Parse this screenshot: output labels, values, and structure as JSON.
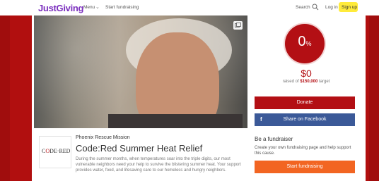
{
  "nav": {
    "logo": "JustGiving",
    "menu": "Menu",
    "start": "Start fundraising",
    "search": "Search",
    "login": "Log in",
    "signup": "Sign up"
  },
  "progress": {
    "percent_number": "0",
    "percent_sign": "%",
    "value": 0.0
  },
  "donation": {
    "amount": "$0",
    "raised_prefix": "raised of",
    "target": "$150,000",
    "raised_suffix": "target",
    "donate": "Donate",
    "share_icon": "f",
    "share": "Share on Facebook"
  },
  "campaign": {
    "charity": "Phoenix Rescue Mission",
    "title": "Code:Red Summer Heat Relief",
    "description": "During the summer months, when temperatures soar into the triple digits, our most vulnerable neighbors need your help to survive the blistering summer heat. Your support provides water, food, and lifesaving care to our homeless and hungry neighbors."
  },
  "charity_logo": {
    "code": "C",
    "o": "O",
    "rest": "DE·RED"
  },
  "fundraiser": {
    "heading": "Be a fundraiser",
    "text": "Create your own fundraising page and help support this cause.",
    "button": "Start fundraising"
  },
  "colors": {
    "brand": "#7b2fbe",
    "accent": "#b30f14",
    "facebook": "#3b5998",
    "orange": "#f26522",
    "highlight": "#ffeb3b"
  },
  "icons": [
    "search-icon",
    "chevron-down-icon",
    "gallery-icon",
    "facebook-icon"
  ]
}
